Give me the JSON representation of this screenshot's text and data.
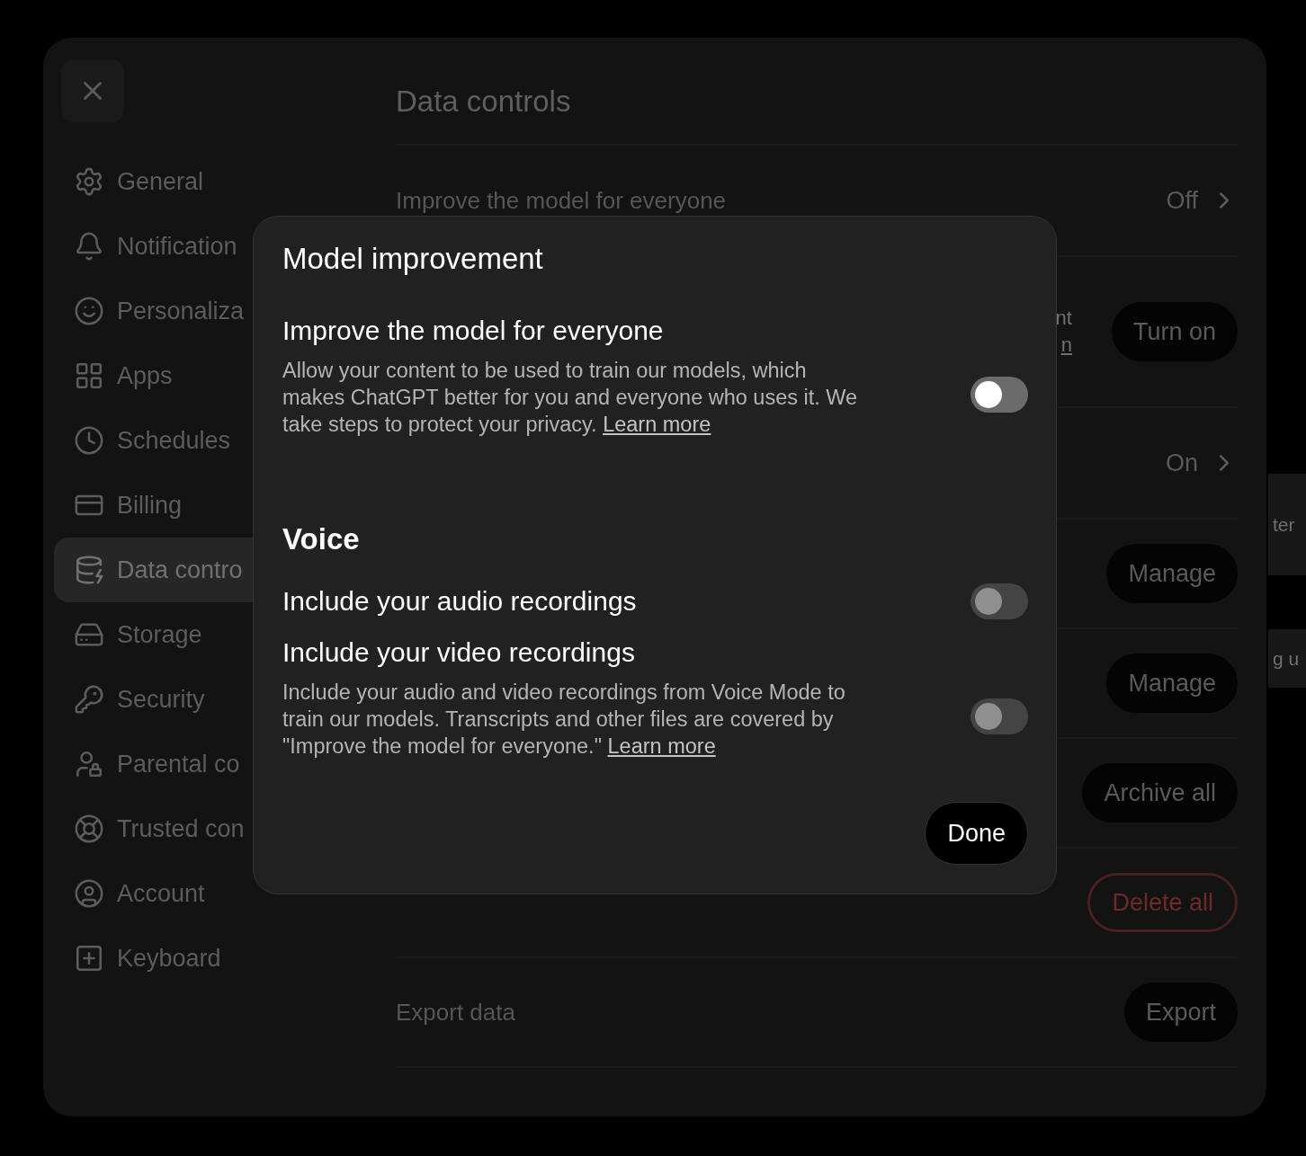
{
  "sidebar": {
    "items": [
      {
        "label": "General",
        "selected": false
      },
      {
        "label": "Notification",
        "selected": false
      },
      {
        "label": "Personaliza",
        "selected": false
      },
      {
        "label": "Apps",
        "selected": false
      },
      {
        "label": "Schedules",
        "selected": false
      },
      {
        "label": "Billing",
        "selected": false
      },
      {
        "label": "Data contro",
        "selected": true
      },
      {
        "label": "Storage",
        "selected": false
      },
      {
        "label": "Security",
        "selected": false
      },
      {
        "label": "Parental co",
        "selected": false
      },
      {
        "label": "Trusted con",
        "selected": false
      },
      {
        "label": "Account",
        "selected": false
      },
      {
        "label": "Keyboard",
        "selected": false
      }
    ]
  },
  "content": {
    "title": "Data controls",
    "rows": [
      {
        "kind": "value",
        "label": "Improve the model for everyone",
        "value": "Off"
      },
      {
        "kind": "button",
        "fragments": [
          "nt",
          "n"
        ],
        "button": "Turn on"
      },
      {
        "kind": "value",
        "value": "On"
      },
      {
        "kind": "button",
        "button": "Manage"
      },
      {
        "kind": "button",
        "button": "Manage"
      },
      {
        "kind": "button",
        "button": "Archive all"
      },
      {
        "kind": "danger",
        "button": "Delete all"
      },
      {
        "kind": "button",
        "label": "Export data",
        "button": "Export"
      }
    ]
  },
  "side_panel": [
    "ter",
    "g u"
  ],
  "dialog": {
    "title": "Model improvement",
    "sections": [
      {
        "settings": [
          {
            "label": "Improve the model for everyone",
            "description": "Allow your content to be used to train our models, which makes ChatGPT better for you and everyone who uses it. We take steps to protect your privacy.",
            "link": "Learn more",
            "on": false,
            "disabled": false
          }
        ]
      },
      {
        "heading": "Voice",
        "settings": [
          {
            "label": "Include your audio recordings",
            "on": false,
            "disabled": true
          },
          {
            "label": "Include your video recordings",
            "description": "Include your audio and video recordings from Voice Mode to train our models. Transcripts and other files are covered by \"Improve the model for everyone.\"",
            "link": "Learn more",
            "on": false,
            "disabled": true
          }
        ]
      }
    ],
    "button": "Done"
  }
}
